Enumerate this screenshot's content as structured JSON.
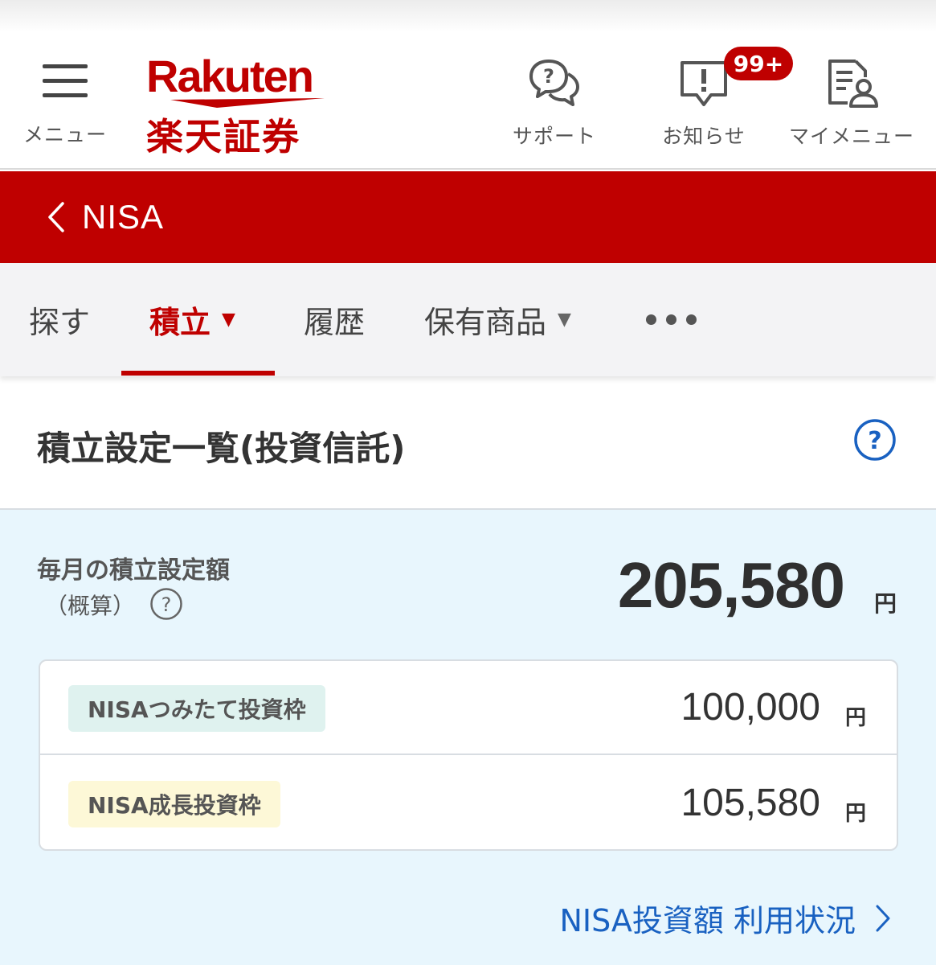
{
  "header": {
    "menu_label": "メニュー",
    "logo_en": "Rakuten",
    "logo_jp": "楽天証券",
    "support_label": "サポート",
    "notice_label": "お知らせ",
    "notice_badge": "99+",
    "mymenu_label": "マイメニュー"
  },
  "nav": {
    "title": "NISA"
  },
  "tabs": [
    {
      "label": "探す"
    },
    {
      "label": "積立"
    },
    {
      "label": "履歴"
    },
    {
      "label": "保有商品"
    }
  ],
  "main": {
    "title": "積立設定一覧(投資信託)",
    "monthly_label": "毎月の積立設定額",
    "monthly_sub": "（概算）",
    "total_amount": "205,580",
    "unit": "円",
    "rows": [
      {
        "label": "NISAつみたて投資枠",
        "amount": "100,000",
        "unit": "円",
        "color": "#dff2ef"
      },
      {
        "label": "NISA成長投資枠",
        "amount": "105,580",
        "unit": "円",
        "color": "#fdf8d7"
      }
    ],
    "usage_link": "NISA投資額 利用状況"
  },
  "colors": {
    "brand_red": "#bf0000",
    "link_blue": "#1961c1",
    "panel_bg": "#e8f6fd"
  }
}
